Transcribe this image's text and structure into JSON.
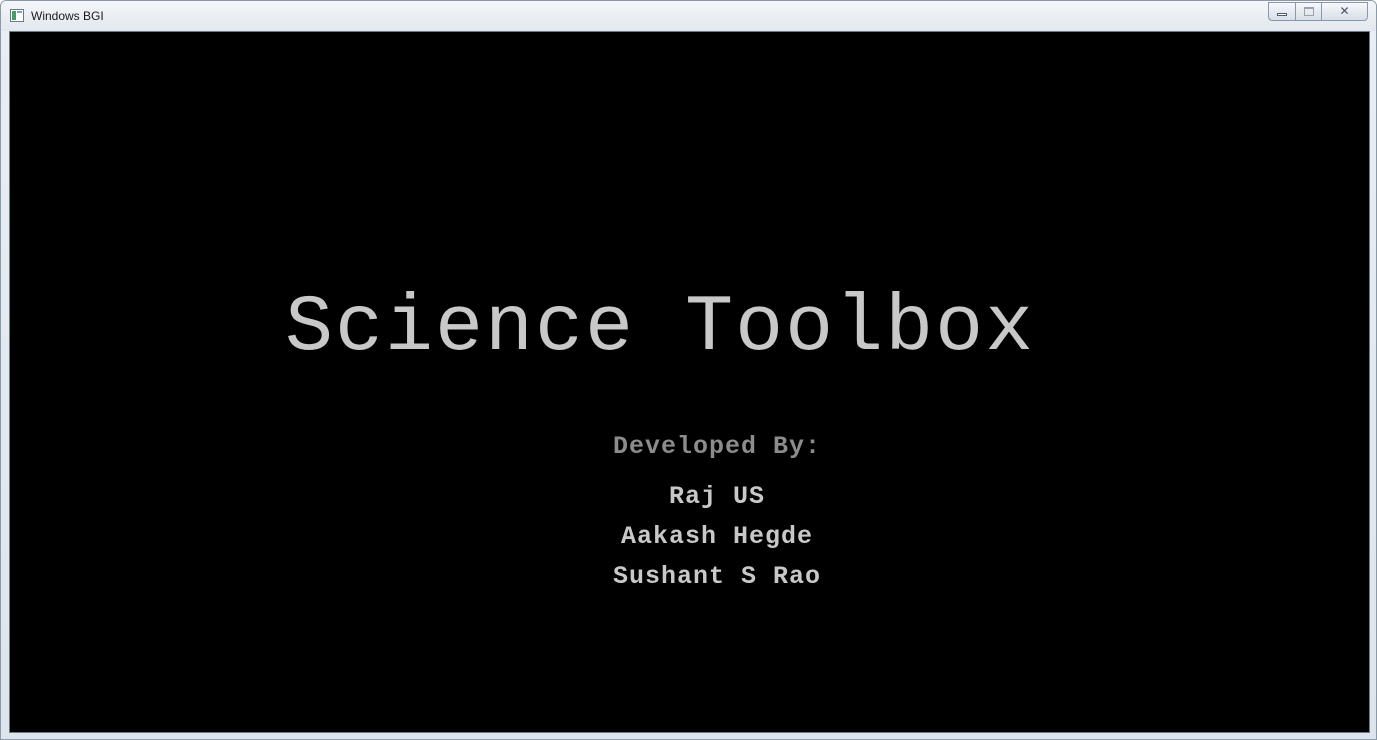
{
  "window": {
    "title": "Windows BGI",
    "icon": "bgi-app-icon"
  },
  "caption_buttons": {
    "minimize_icon": "minimize-icon",
    "maximize_icon": "maximize-icon",
    "close_icon": "close-icon",
    "close_glyph": "✕"
  },
  "screen": {
    "background": "#000000",
    "text_color": "#c8c8c8",
    "subtitle_color": "#8c8c8c",
    "title": "Science Toolbox",
    "developed_by_label": "Developed By:",
    "developers": [
      "Raj US",
      "Aakash Hegde",
      "Sushant S Rao"
    ]
  }
}
